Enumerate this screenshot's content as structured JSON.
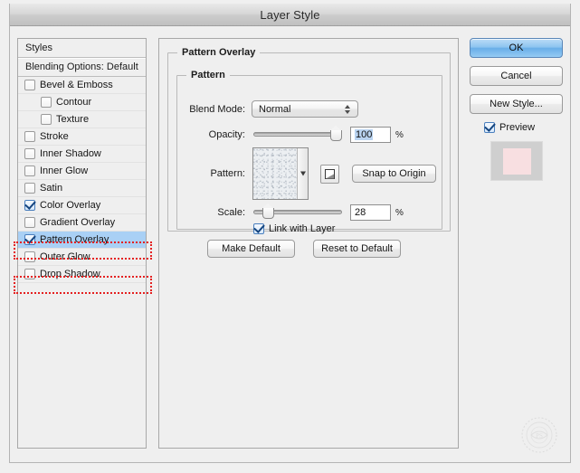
{
  "window": {
    "title": "Layer Style"
  },
  "sidebar": {
    "header": "Styles",
    "blending_options": "Blending Options: Default",
    "items": [
      {
        "label": "Bevel & Emboss",
        "checked": false,
        "indent": false,
        "selected": false
      },
      {
        "label": "Contour",
        "checked": false,
        "indent": true,
        "selected": false
      },
      {
        "label": "Texture",
        "checked": false,
        "indent": true,
        "selected": false
      },
      {
        "label": "Stroke",
        "checked": false,
        "indent": false,
        "selected": false
      },
      {
        "label": "Inner Shadow",
        "checked": false,
        "indent": false,
        "selected": false
      },
      {
        "label": "Inner Glow",
        "checked": false,
        "indent": false,
        "selected": false
      },
      {
        "label": "Satin",
        "checked": false,
        "indent": false,
        "selected": false
      },
      {
        "label": "Color Overlay",
        "checked": true,
        "indent": false,
        "selected": false
      },
      {
        "label": "Gradient Overlay",
        "checked": false,
        "indent": false,
        "selected": false
      },
      {
        "label": "Pattern Overlay",
        "checked": true,
        "indent": false,
        "selected": true
      },
      {
        "label": "Outer Glow",
        "checked": false,
        "indent": false,
        "selected": false
      },
      {
        "label": "Drop Shadow",
        "checked": false,
        "indent": false,
        "selected": false
      }
    ]
  },
  "annotations": {
    "color": "#e42020",
    "boxes": [
      {
        "target": "Color Overlay"
      },
      {
        "target": "Pattern Overlay"
      }
    ]
  },
  "main": {
    "group_title": "Pattern Overlay",
    "subgroup_title": "Pattern",
    "blend_mode": {
      "label": "Blend Mode:",
      "value": "Normal"
    },
    "opacity": {
      "label": "Opacity:",
      "value": "100",
      "unit": "%",
      "slider_percent": 100
    },
    "pattern": {
      "label": "Pattern:",
      "snap_button": "Snap to Origin",
      "new_preset_icon": "new-pattern-preset-icon"
    },
    "scale": {
      "label": "Scale:",
      "value": "28",
      "unit": "%",
      "slider_percent": 12
    },
    "link_with_layer": {
      "label": "Link with Layer",
      "checked": true
    },
    "make_default": "Make Default",
    "reset_to_default": "Reset to Default"
  },
  "right": {
    "ok": "OK",
    "cancel": "Cancel",
    "new_style": "New Style...",
    "preview": {
      "label": "Preview",
      "checked": true
    },
    "preview_swatch": {
      "outer_color": "#cfcfcf",
      "inner_color": "#f8dfe1"
    }
  }
}
